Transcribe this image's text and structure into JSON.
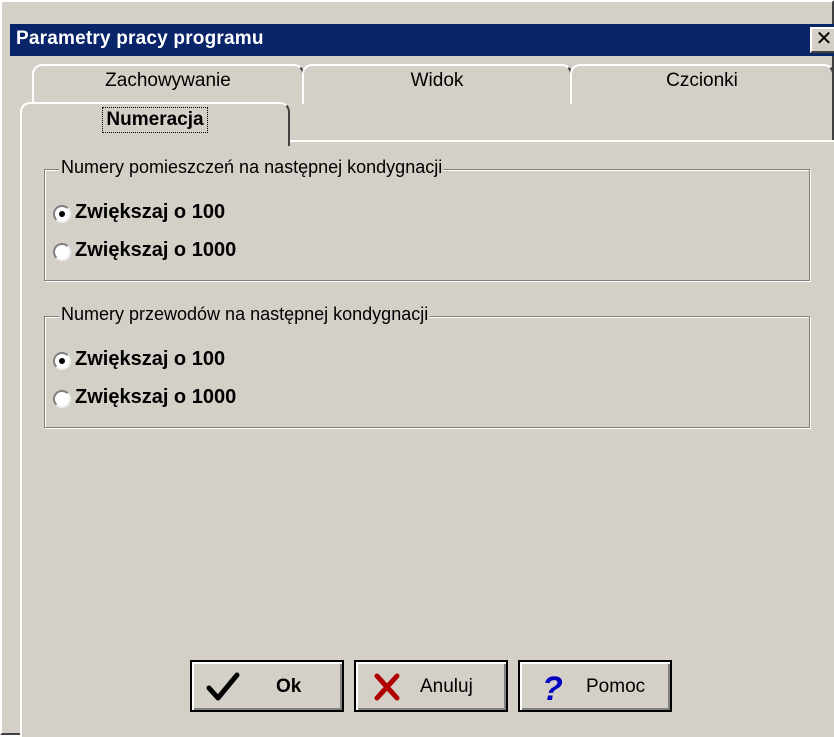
{
  "window": {
    "title": "Parametry pracy programu",
    "close_glyph": "✕"
  },
  "tabs": [
    {
      "label": "Zachowywanie",
      "active": false
    },
    {
      "label": "Widok",
      "active": false
    },
    {
      "label": "Czcionki",
      "active": false
    },
    {
      "label": "Numeracja",
      "active": true
    }
  ],
  "groups": [
    {
      "title": "Numery pomieszczeń na następnej kondygnacji",
      "options": [
        {
          "label": "Zwiększaj o 100",
          "selected": true
        },
        {
          "label": "Zwiększaj o 1000",
          "selected": false
        }
      ]
    },
    {
      "title": "Numery przewodów na następnej kondygnacji",
      "options": [
        {
          "label": "Zwiększaj o 100",
          "selected": true
        },
        {
          "label": "Zwiększaj o 1000",
          "selected": false
        }
      ]
    }
  ],
  "buttons": {
    "ok": {
      "label": "Ok",
      "icon": "checkmark-icon",
      "icon_color": "#000000"
    },
    "cancel": {
      "label": "Anuluj",
      "icon": "x-cross-icon",
      "icon_color": "#b00000"
    },
    "help": {
      "label": "Pomoc",
      "icon": "question-mark-icon",
      "icon_color": "#0000c0"
    }
  },
  "colors": {
    "title_bar": "#0a246a",
    "face": "#d4d0c8"
  }
}
